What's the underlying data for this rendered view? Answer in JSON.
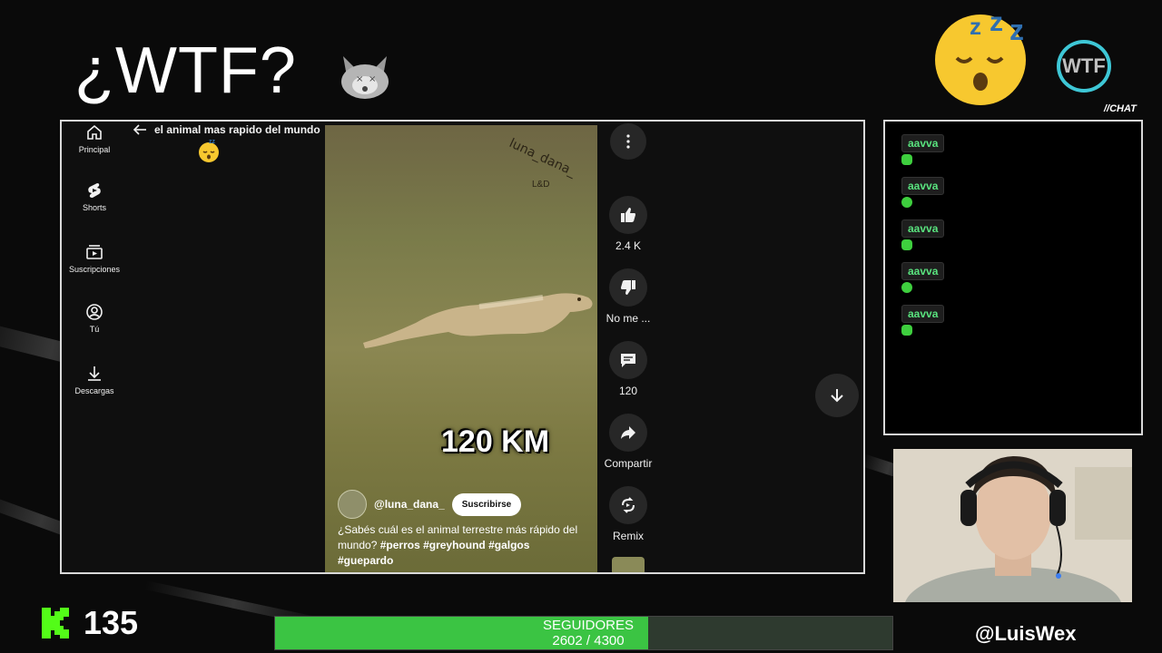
{
  "overlay": {
    "title": "¿WTF?",
    "brand_logo_text": "WTF",
    "chat_tag": "//CHAT",
    "follower_goal_label": "SEGUIDORES",
    "follower_goal_value": "2602 / 4300",
    "follower_goal_progress": 0.605,
    "viewer_count": "135",
    "streamer_handle": "@LuisWex",
    "accent_color": "#3bc443"
  },
  "youtube": {
    "sidebar": [
      {
        "label": "Principal",
        "icon": "home-icon"
      },
      {
        "label": "Shorts",
        "icon": "shorts-icon"
      },
      {
        "label": "Suscripciones",
        "icon": "subscriptions-icon"
      },
      {
        "label": "Tú",
        "icon": "account-icon"
      },
      {
        "label": "Descargas",
        "icon": "download-icon"
      }
    ],
    "search_query": "el animal mas rapido del mundo",
    "video": {
      "watermark": "luna_dana_",
      "watermark_sub": "L&D",
      "overlay_text": "120 KM",
      "channel": "@luna_dana_",
      "subscribe_label": "Suscribirse",
      "description": "¿Sabés cuál es el animal terrestre más rápido del mundo?",
      "hashtags": "#perros #greyhound #galgos #guepardo"
    },
    "actions": [
      {
        "label": "",
        "icon": "more-vertical-icon"
      },
      {
        "label": "2.4 K",
        "icon": "thumbs-up-icon"
      },
      {
        "label": "No me ...",
        "icon": "thumbs-down-icon"
      },
      {
        "label": "120",
        "icon": "comment-icon"
      },
      {
        "label": "Compartir",
        "icon": "share-icon"
      },
      {
        "label": "Remix",
        "icon": "remix-icon"
      }
    ]
  },
  "chat": {
    "messages": [
      {
        "user": "aavva"
      },
      {
        "user": "aavva"
      },
      {
        "user": "aavva"
      },
      {
        "user": "aavva"
      },
      {
        "user": "aavva"
      }
    ]
  }
}
